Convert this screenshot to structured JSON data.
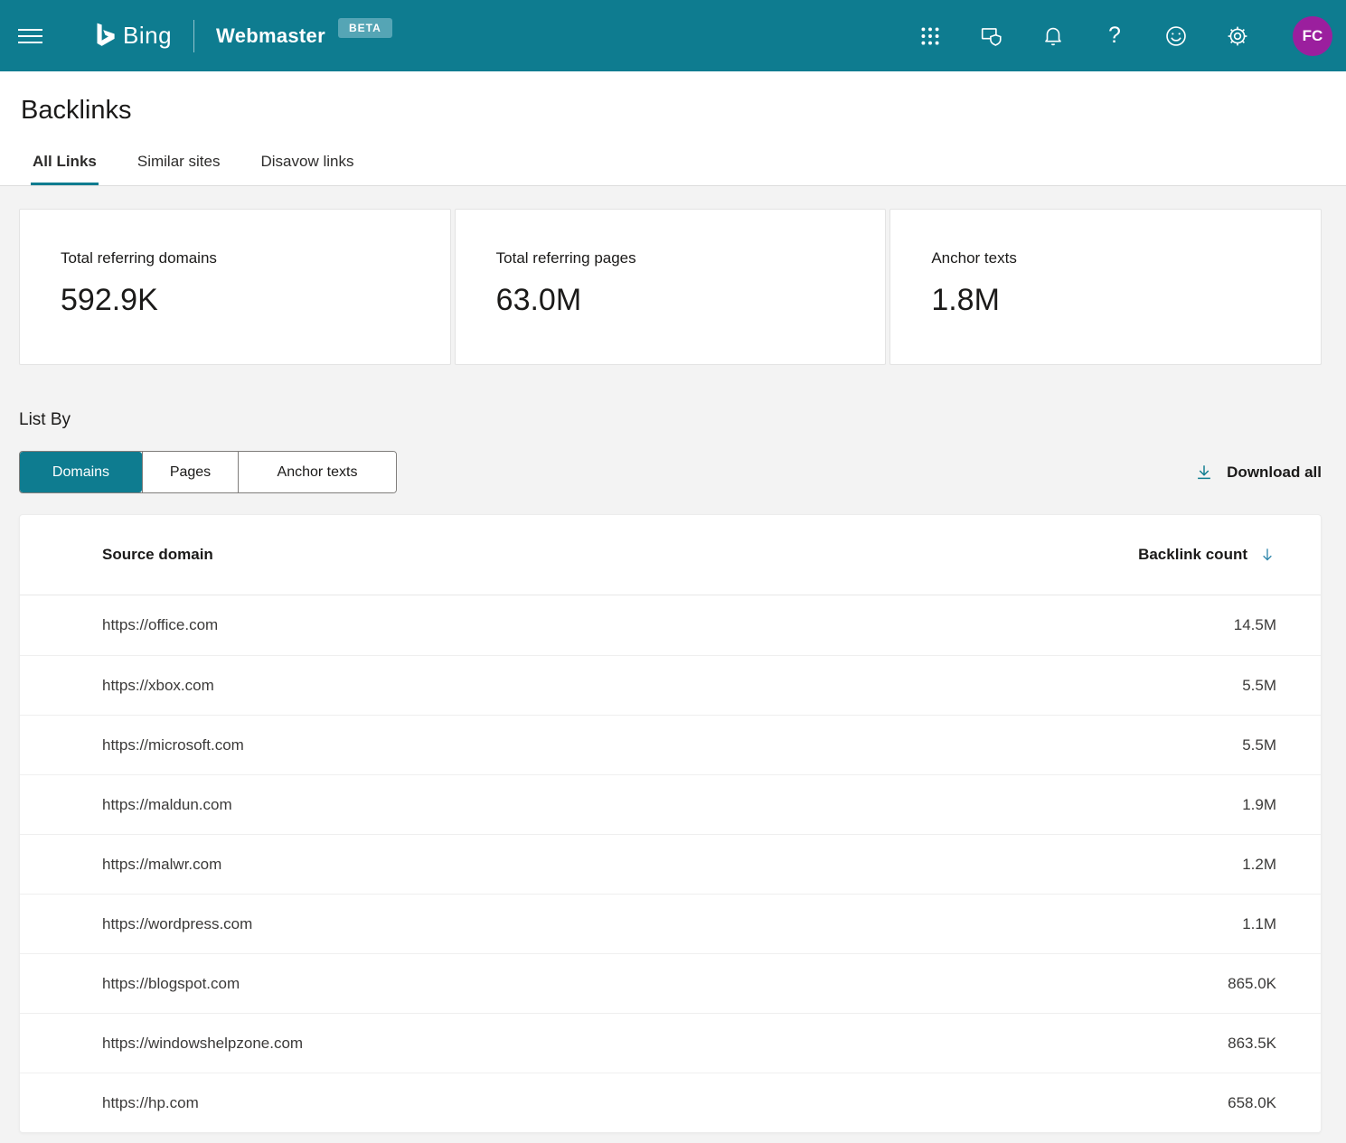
{
  "colors": {
    "header_bg": "#0e7c90",
    "accent_teal": "#0e7c90",
    "beta_badge_bg": "#55a5b5",
    "avatar_bg": "#9b1f9e",
    "page_bg": "#f3f3f3",
    "sort_arrow": "#2e86ab",
    "text_primary": "#1b1a19",
    "text_secondary": "#3b3a39"
  },
  "header": {
    "brand": "Bing",
    "product": "Webmaster",
    "beta": "BETA",
    "help_glyph": "?",
    "avatar_initials": "FC"
  },
  "page": {
    "title": "Backlinks"
  },
  "tabs": [
    {
      "label": "All Links",
      "active": true
    },
    {
      "label": "Similar sites",
      "active": false
    },
    {
      "label": "Disavow links",
      "active": false
    }
  ],
  "stats": [
    {
      "label": "Total referring domains",
      "value": "592.9K"
    },
    {
      "label": "Total referring pages",
      "value": "63.0M"
    },
    {
      "label": "Anchor texts",
      "value": "1.8M"
    }
  ],
  "listby": {
    "label": "List By",
    "options": [
      "Domains",
      "Pages",
      "Anchor texts"
    ],
    "selected": "Domains",
    "download": "Download all"
  },
  "table": {
    "columns": {
      "domain": "Source domain",
      "count": "Backlink count"
    },
    "sort": {
      "column": "Backlink count",
      "direction": "desc"
    },
    "rows": [
      {
        "domain": "https://office.com",
        "count": "14.5M"
      },
      {
        "domain": "https://xbox.com",
        "count": "5.5M"
      },
      {
        "domain": "https://microsoft.com",
        "count": "5.5M"
      },
      {
        "domain": "https://maldun.com",
        "count": "1.9M"
      },
      {
        "domain": "https://malwr.com",
        "count": "1.2M"
      },
      {
        "domain": "https://wordpress.com",
        "count": "1.1M"
      },
      {
        "domain": "https://blogspot.com",
        "count": "865.0K"
      },
      {
        "domain": "https://windowshelpzone.com",
        "count": "863.5K"
      },
      {
        "domain": "https://hp.com",
        "count": "658.0K"
      }
    ]
  }
}
